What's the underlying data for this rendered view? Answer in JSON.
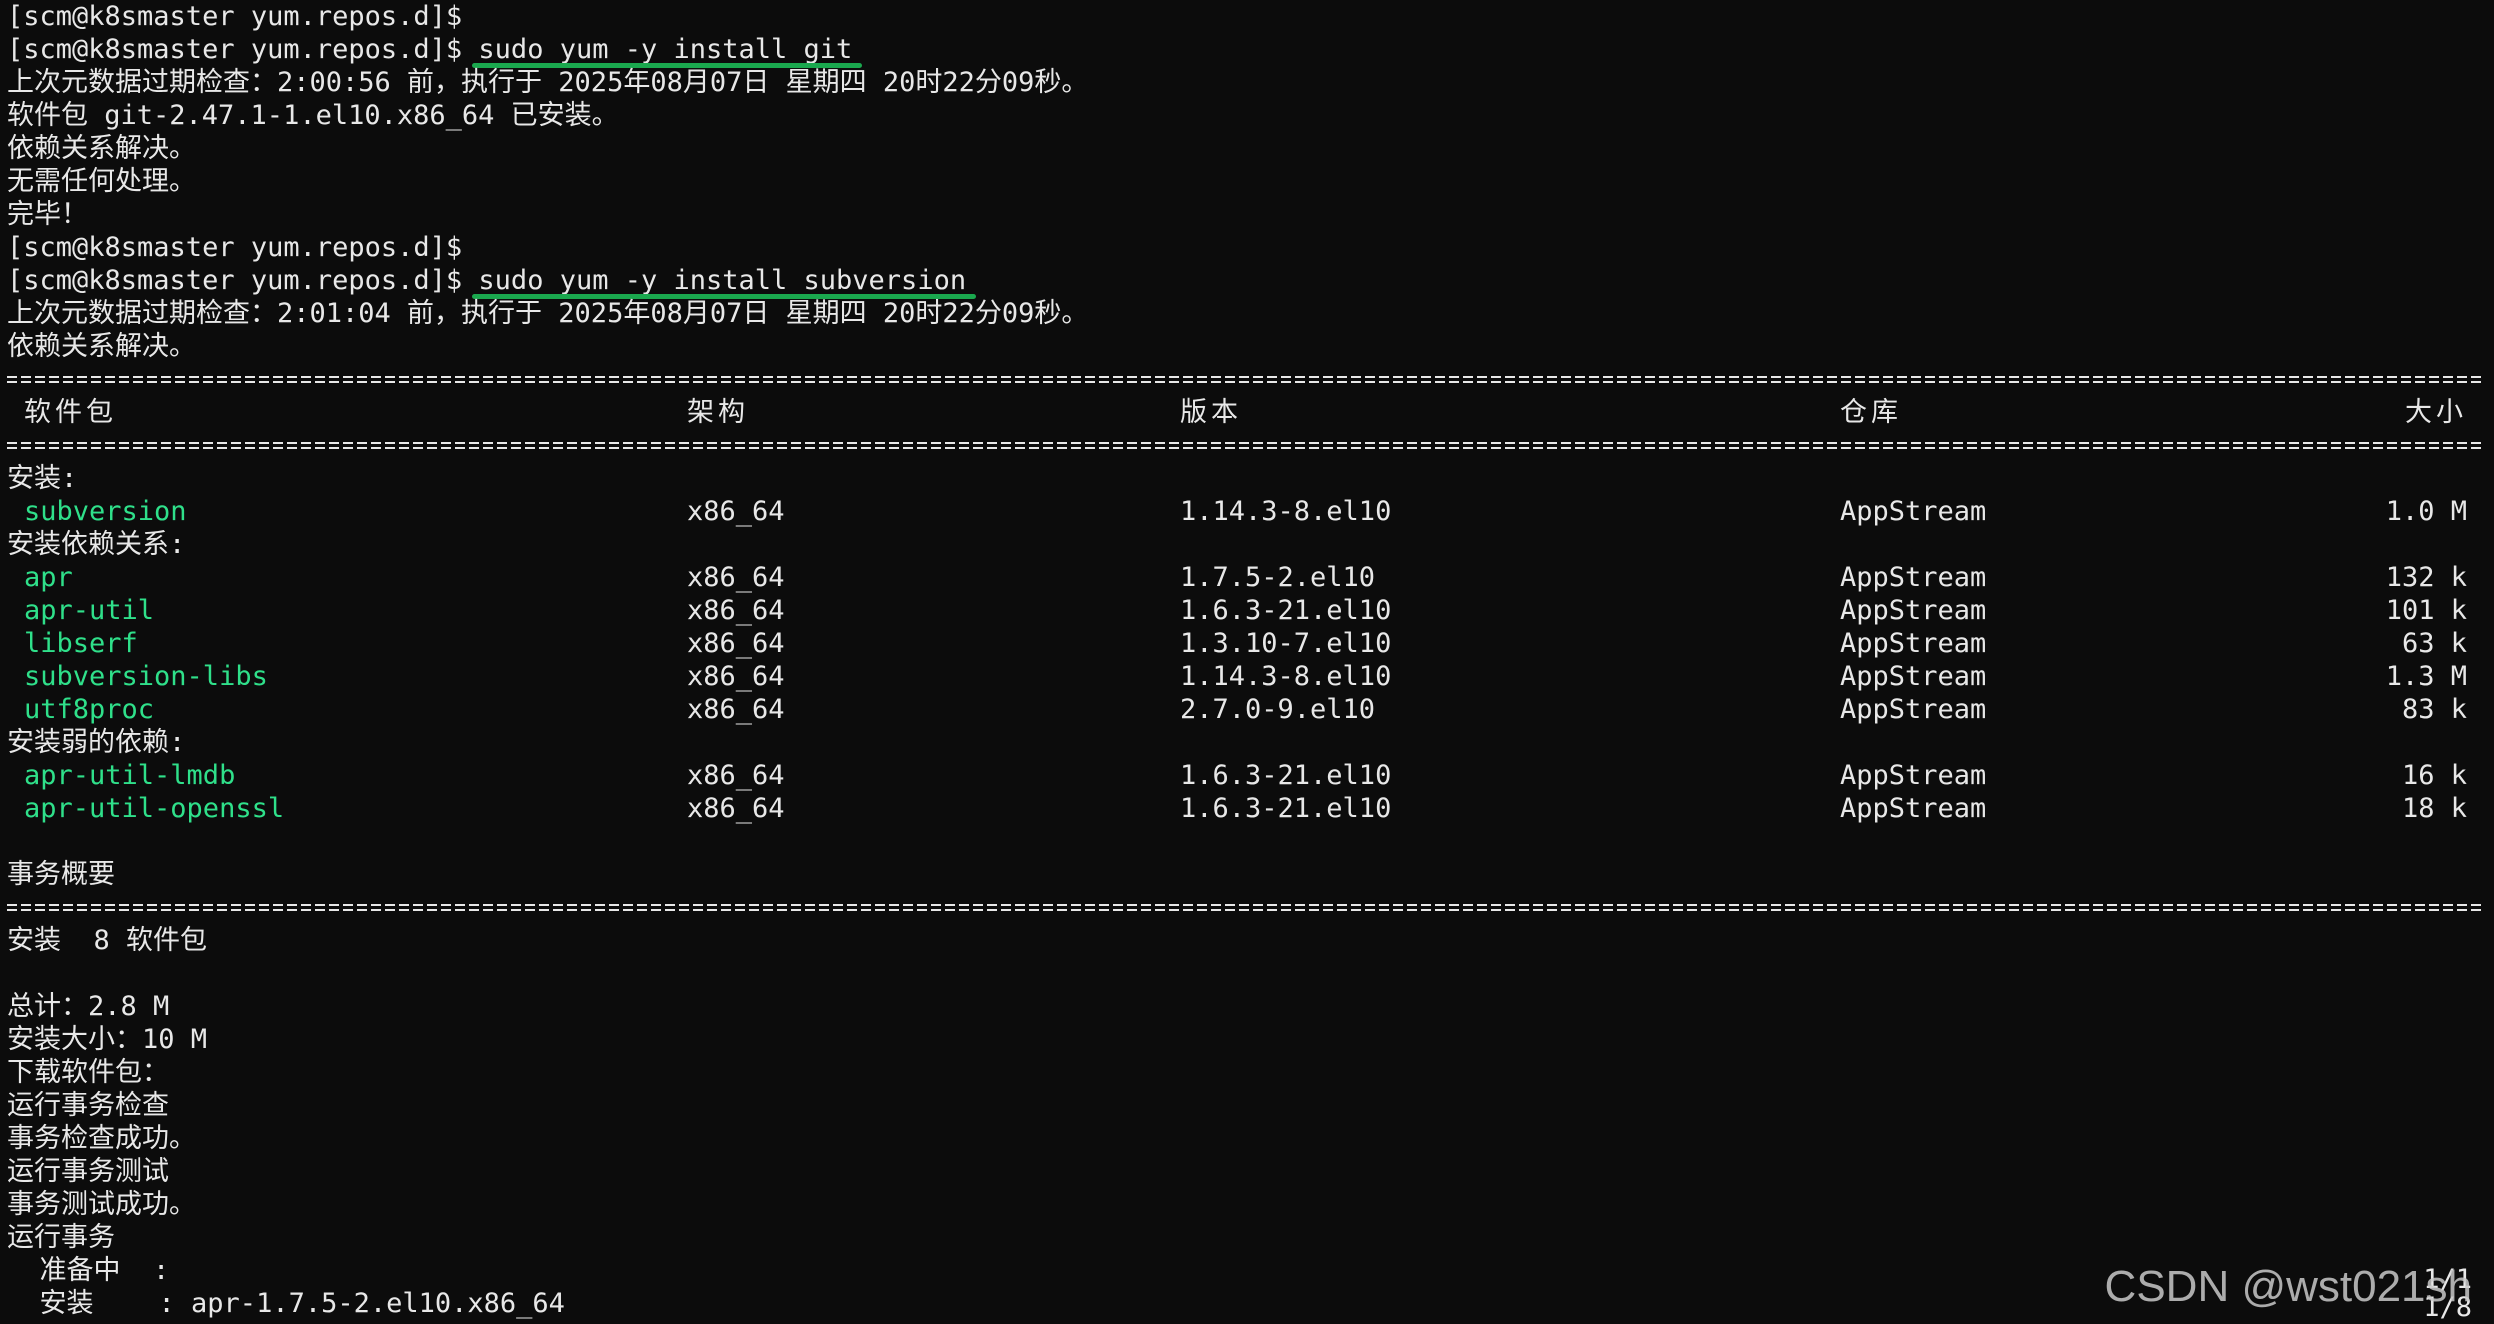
{
  "terminal": {
    "prompt": "[scm@k8smaster yum.repos.d]$",
    "cmd_git": "sudo yum -y install git",
    "cmd_svn": "sudo yum -y install subversion",
    "git_out": [
      "上次元数据过期检查：2:00:56 前，执行于 2025年08月07日 星期四 20时22分09秒。",
      "软件包 git-2.47.1-1.el10.x86_64 已安装。",
      "依赖关系解决。",
      "无需任何处理。",
      "完毕！"
    ],
    "svn_out": [
      "上次元数据过期检查：2:01:04 前，执行于 2025年08月07日 星期四 20时22分09秒。",
      "依赖关系解决。"
    ],
    "table_header": {
      "name": "软件包",
      "arch": "架构",
      "version": "版本",
      "repo": "仓库",
      "size": "大小"
    },
    "section_install": "安装:",
    "install_pkgs": [
      {
        "name": "subversion",
        "arch": "x86_64",
        "version": "1.14.3-8.el10",
        "repo": "AppStream",
        "size": "1.0 M"
      }
    ],
    "section_deps": "安装依赖关系:",
    "dep_pkgs": [
      {
        "name": "apr",
        "arch": "x86_64",
        "version": "1.7.5-2.el10",
        "repo": "AppStream",
        "size": "132 k"
      },
      {
        "name": "apr-util",
        "arch": "x86_64",
        "version": "1.6.3-21.el10",
        "repo": "AppStream",
        "size": "101 k"
      },
      {
        "name": "libserf",
        "arch": "x86_64",
        "version": "1.3.10-7.el10",
        "repo": "AppStream",
        "size": "63 k"
      },
      {
        "name": "subversion-libs",
        "arch": "x86_64",
        "version": "1.14.3-8.el10",
        "repo": "AppStream",
        "size": "1.3 M"
      },
      {
        "name": "utf8proc",
        "arch": "x86_64",
        "version": "2.7.0-9.el10",
        "repo": "AppStream",
        "size": "83 k"
      }
    ],
    "section_weak": "安装弱的依赖:",
    "weak_pkgs": [
      {
        "name": "apr-util-lmdb",
        "arch": "x86_64",
        "version": "1.6.3-21.el10",
        "repo": "AppStream",
        "size": "16 k"
      },
      {
        "name": "apr-util-openssl",
        "arch": "x86_64",
        "version": "1.6.3-21.el10",
        "repo": "AppStream",
        "size": "18 k"
      }
    ],
    "summary_title": "事务概要",
    "summary_install": "安装  8 软件包",
    "tail": [
      "总计：2.8 M",
      "安装大小：10 M",
      "下载软件包：",
      "运行事务检查",
      "事务检查成功。",
      "运行事务测试",
      "事务测试成功。",
      "运行事务",
      "  准备中  :",
      "  安装    : apr-1.7.5-2.el10.x86_64"
    ],
    "progress_1": "1/1",
    "progress_2": "1/8"
  },
  "watermark": "CSDN @wst021sh"
}
